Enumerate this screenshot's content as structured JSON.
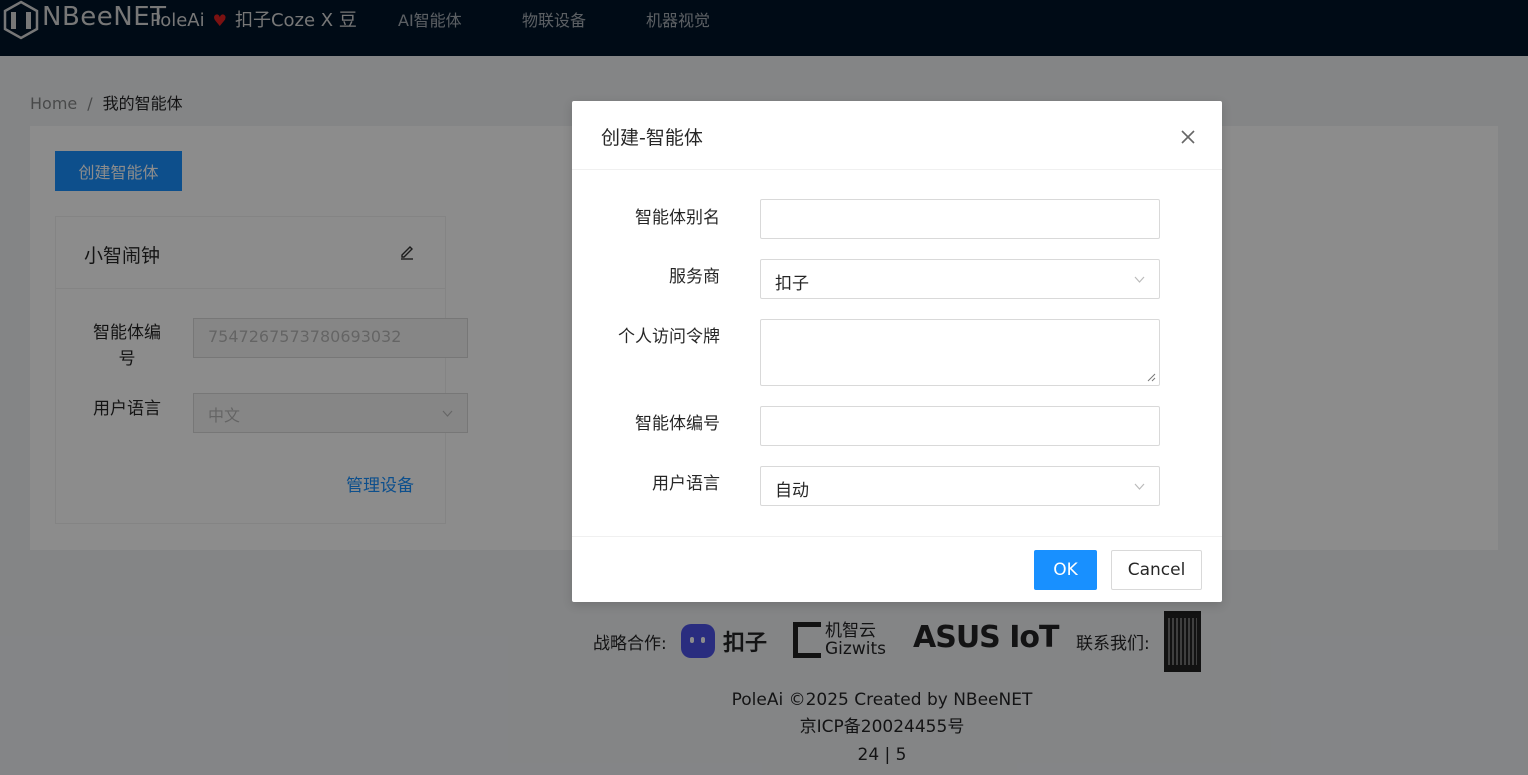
{
  "header": {
    "brand": "NBeeNET",
    "tagline_left": "PoleAi",
    "tagline_right": "扣子Coze X 豆",
    "nav": [
      "AI智能体",
      "物联设备",
      "机器视觉"
    ]
  },
  "breadcrumb": {
    "home": "Home",
    "sep": "/",
    "current": "我的智能体"
  },
  "create_button": "创建智能体",
  "card": {
    "title": "小智闹钟",
    "id_label": "智能体编号",
    "id_value": "7547267573780693032",
    "lang_label": "用户语言",
    "lang_value": "中文",
    "manage_link": "管理设备"
  },
  "modal": {
    "title": "创建-智能体",
    "fields": {
      "alias_label": "智能体别名",
      "alias_value": "",
      "provider_label": "服务商",
      "provider_value": "扣子",
      "token_label": "个人访问令牌",
      "token_value": "",
      "agent_id_label": "智能体编号",
      "agent_id_value": "",
      "lang_label": "用户语言",
      "lang_value": "自动"
    },
    "ok": "OK",
    "cancel": "Cancel"
  },
  "footer": {
    "partners_label": "战略合作:",
    "partners": [
      "扣子",
      "机智云 Gizwits",
      "ASUS IoT"
    ],
    "contact_label": "联系我们:",
    "copyright": "PoleAi ©2025 Created by NBeeNET",
    "icp": "京ICP备20024455号",
    "counter": "24 | 5"
  }
}
